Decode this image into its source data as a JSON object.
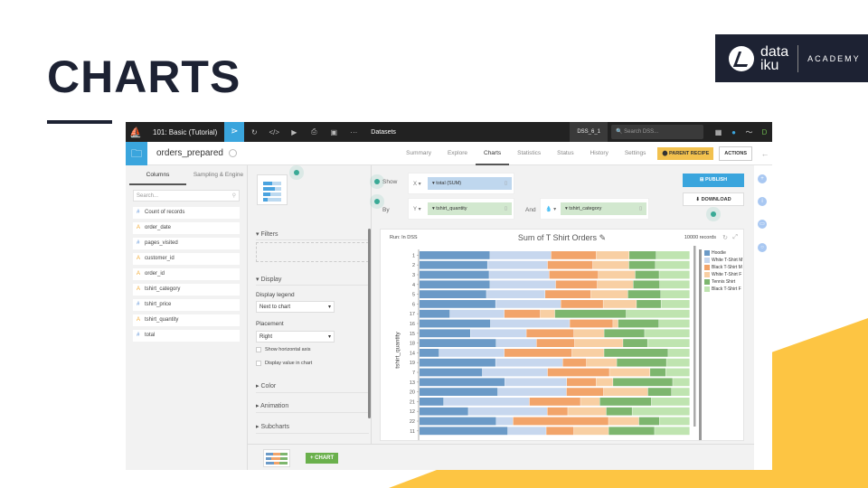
{
  "slide": {
    "title": "CHARTS"
  },
  "logo": {
    "word_line1": "data",
    "word_line2": "iku",
    "tagline": "ACADEMY"
  },
  "topbar": {
    "project": "101: Basic (Tutorial)",
    "section": "Datasets",
    "instance": "DSS_6_1",
    "search_placeholder": "Search DSS...",
    "avatar_initial": "D"
  },
  "header": {
    "dataset_name": "orders_prepared",
    "tabs": [
      "Summary",
      "Explore",
      "Charts",
      "Statistics",
      "Status",
      "History",
      "Settings"
    ],
    "active_tab": "Charts",
    "parent_recipe_label": "PARENT RECIPE",
    "actions_label": "ACTIONS"
  },
  "columns_panel": {
    "tabs": [
      "Columns",
      "Sampling & Engine"
    ],
    "search_placeholder": "Search...",
    "columns": [
      {
        "type": "num",
        "glyph": "#",
        "name": "Count of records"
      },
      {
        "type": "alpha",
        "glyph": "A",
        "name": "order_date"
      },
      {
        "type": "num",
        "glyph": "#",
        "name": "pages_visited"
      },
      {
        "type": "alpha",
        "glyph": "A",
        "name": "customer_id"
      },
      {
        "type": "alpha",
        "glyph": "A",
        "name": "order_id"
      },
      {
        "type": "alpha",
        "glyph": "A",
        "name": "tshirt_category"
      },
      {
        "type": "num",
        "glyph": "#",
        "name": "tshirt_price"
      },
      {
        "type": "alpha",
        "glyph": "A",
        "name": "tshirt_quantity"
      },
      {
        "type": "num",
        "glyph": "#",
        "name": "total"
      }
    ]
  },
  "options_panel": {
    "filters_label": "Filters",
    "display_label": "Display",
    "display_legend_label": "Display legend",
    "display_legend_value": "Next to chart",
    "placement_label": "Placement",
    "placement_value": "Right",
    "show_horizontal_axis_label": "Show horizontal axis",
    "display_value_label": "Display value in chart",
    "color_label": "Color",
    "animation_label": "Animation",
    "subcharts_label": "Subcharts",
    "add_chart_label": "+ CHART"
  },
  "builder": {
    "show_label": "Show",
    "by_label": "By",
    "and_label": "And",
    "x_axis": "X",
    "x_field": "total (SUM)",
    "y_axis": "Y",
    "y_field": "tshirt_quantity",
    "color_field": "tshirt_category",
    "publish_label": "PUBLISH",
    "download_label": "DOWNLOAD"
  },
  "chart_card": {
    "run_label": "Run: In DSS",
    "records": "10000 records"
  },
  "chart_data": {
    "type": "bar",
    "orientation": "horizontal",
    "stacking": "percent",
    "title": "Sum of T Shirt Orders",
    "xlabel": "",
    "ylabel": "tshirt_quantity",
    "categories": [
      "1",
      "2",
      "3",
      "4",
      "5",
      "6",
      "17",
      "16",
      "15",
      "18",
      "14",
      "19",
      "7",
      "13",
      "20",
      "21",
      "12",
      "22",
      "11"
    ],
    "series": [
      {
        "name": "Hoodie",
        "color": "#6b9ac7",
        "values": [
          26.1,
          25.2,
          25.8,
          26.1,
          24.8,
          28.2,
          11.3,
          26.3,
          18.9,
          28.4,
          7.3,
          28.2,
          23.3,
          31.6,
          29.0,
          9.0,
          18.1,
          28.4,
          32.7
        ]
      },
      {
        "name": "White T-Shirt M",
        "color": "#c7d7ee",
        "values": [
          22.6,
          22.2,
          22.2,
          24.3,
          21.7,
          24.1,
          20.1,
          29.3,
          20.7,
          14.9,
          24.1,
          24.8,
          24.1,
          22.9,
          25.4,
          31.7,
          29.2,
          6.2,
          14.2
        ]
      },
      {
        "name": "Black T-Shirt M",
        "color": "#f2a46a",
        "values": [
          16.7,
          16.7,
          18.2,
          15.4,
          16.9,
          15.7,
          13.3,
          16.0,
          17.6,
          14.1,
          25.0,
          8.8,
          22.9,
          10.9,
          13.7,
          18.9,
          7.6,
          35.3,
          10.2
        ]
      },
      {
        "name": "White T-Shirt F",
        "color": "#f8cfa3",
        "values": [
          12.2,
          13.4,
          13.6,
          13.3,
          13.7,
          12.3,
          5.4,
          1.9,
          11.2,
          17.9,
          11.9,
          11.2,
          15.0,
          6.2,
          16.4,
          7.1,
          14.2,
          11.2,
          12.9
        ]
      },
      {
        "name": "Tennis Shirt",
        "color": "#7db66e",
        "values": [
          10.0,
          9.8,
          8.9,
          9.8,
          12.2,
          9.1,
          26.4,
          15.1,
          15.0,
          9.1,
          23.7,
          18.4,
          5.8,
          22.1,
          8.8,
          19.1,
          9.6,
          7.6,
          17.0
        ]
      },
      {
        "name": "Black T-Shirt F",
        "color": "#bfe4b0",
        "values": [
          12.4,
          12.7,
          11.3,
          11.1,
          10.7,
          10.6,
          23.5,
          11.4,
          16.7,
          15.6,
          8.0,
          8.6,
          8.9,
          6.3,
          6.7,
          14.2,
          21.3,
          11.2,
          13.0
        ]
      }
    ],
    "legend": "right",
    "grid": false
  }
}
